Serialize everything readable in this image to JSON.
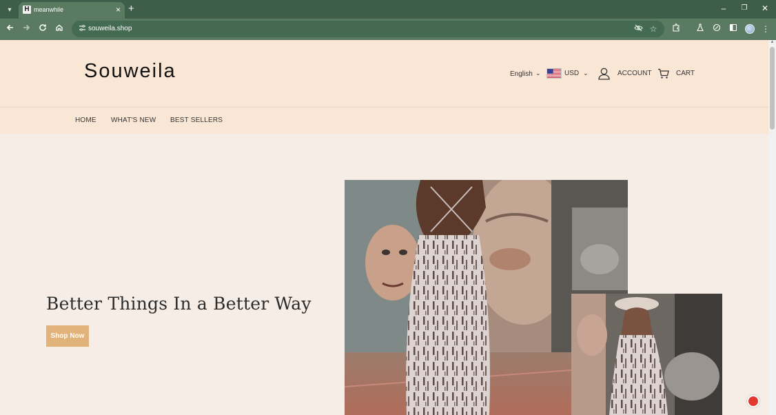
{
  "browser": {
    "tab_title": "meanwhile",
    "favicon_letter": "H",
    "url": "souweila.shop"
  },
  "site": {
    "logo": "Souweila",
    "language": "English",
    "currency": "USD",
    "account_label": "ACCOUNT",
    "cart_label": "CART",
    "nav": [
      "HOME",
      "WHAT'S NEW",
      "BEST SELLERS"
    ]
  },
  "hero": {
    "title": "Better Things In a Better Way",
    "button": "Shop Now"
  },
  "colors": {
    "header_bg": "#f9e6d5",
    "page_bg": "#f6ede6",
    "button_bg": "#e1b279",
    "browser_frame": "#3e5e49"
  },
  "icons": {
    "back": "arrow-left-icon",
    "forward": "arrow-right-icon",
    "reload": "reload-icon",
    "home": "home-icon",
    "account": "user-icon",
    "cart": "cart-icon"
  }
}
